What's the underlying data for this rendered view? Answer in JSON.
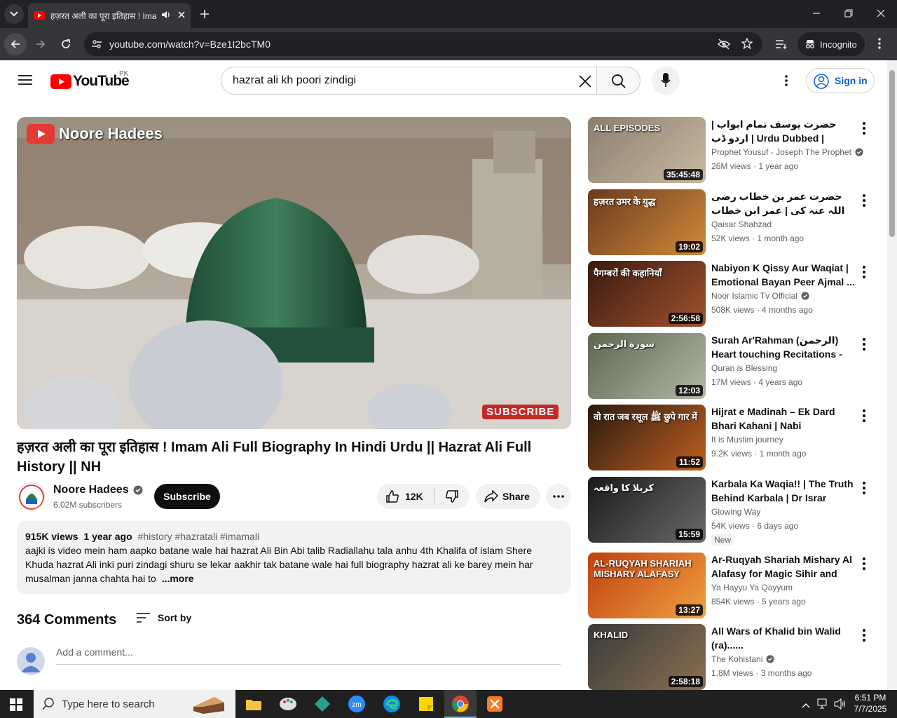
{
  "browser": {
    "tab_title": "हज़रत अली का पूरा इतिहास ! Imam Ali Full Biography In Hindi Urdu || Hazrat Ali Full History || NH",
    "url": "youtube.com/watch?v=Bze1I2bcTM0",
    "incognito_label": "Incognito"
  },
  "youtube": {
    "logo_text": "YouTube",
    "country": "PK",
    "search_value": "hazrat ali kh poori zindigi",
    "sign_in": "Sign in"
  },
  "video": {
    "watermark": "Noore Hadees",
    "subscribe_overlay": "SUBSCRIBE",
    "title": "हज़रत अली का पूरा इतिहास ! Imam Ali Full Biography In Hindi Urdu || Hazrat Ali Full History || NH",
    "channel_name": "Noore Hadees",
    "subscribers": "6.02M subscribers",
    "subscribe_button": "Subscribe",
    "likes": "12K",
    "share": "Share",
    "views": "915K views",
    "age": "1 year ago",
    "hashtags": "#history #hazratali #imamali",
    "description": "aajki is video mein ham aapko batane wale hai hazrat Ali Bin Abi talib Radiallahu tala anhu 4th Khalifa of islam Shere Khuda hazrat Ali inki puri zindagi shuru se lekar aakhir tak batane wale hai full biography hazrat ali ke barey mein har musalman janna chahta hai to",
    "more": "...more"
  },
  "comments": {
    "count": "364 Comments",
    "sort_by": "Sort by",
    "placeholder": "Add a comment..."
  },
  "recommendations": [
    {
      "title": "حضرت یوسف تمام ابواب | اردو ڈب | Urdu Dubbed | Joseph The ...",
      "channel": "Prophet Yousuf - Joseph The Prophet",
      "verified": true,
      "views": "26M views",
      "age": "1 year ago",
      "duration": "35:45:48",
      "thumb_text": "ALL EPISODES",
      "colors": [
        "#8a7f70",
        "#c9b9a0"
      ]
    },
    {
      "title": "حضرت عمر بن خطاب رضی اللہ عنہ کی | عمر ابن خطاب کی فتوحات | حقیقی تاریخ...",
      "channel": "Qaisar Shahzad",
      "verified": false,
      "views": "52K views",
      "age": "1 month ago",
      "duration": "19:02",
      "thumb_text": "हज़रत उमर के युद्ध",
      "colors": [
        "#6b3a1e",
        "#d08a3a"
      ]
    },
    {
      "title": "Nabiyon K Qissy Aur Waqiat | Emotional Bayan Peer Ajmal ...",
      "channel": "Noor Islamic Tv Official",
      "verified": true,
      "views": "508K views",
      "age": "4 months ago",
      "duration": "2:56:58",
      "thumb_text": "पैगम्बरों की कहानियाँ",
      "colors": [
        "#3a1a10",
        "#a0522d"
      ]
    },
    {
      "title": "Surah Ar'Rahman (الرحمن)  Heart touching Recitations - Quran i...",
      "channel": "Quran is Blessing",
      "verified": false,
      "views": "17M views",
      "age": "4 years ago",
      "duration": "12:03",
      "thumb_text": "سورة الرحمن",
      "colors": [
        "#5c6650",
        "#b3b8a6"
      ]
    },
    {
      "title": "Hijrat e Madinah – Ek Dard Bhari Kahani | Nabi Muhamma...",
      "channel": "It is Muslim journey",
      "verified": false,
      "views": "9.2K views",
      "age": "1 month ago",
      "duration": "11:52",
      "thumb_text": "वो रात जब रसूल ﷺ छुपे गार में",
      "colors": [
        "#2a1a10",
        "#c06020"
      ]
    },
    {
      "title": "Karbala Ka Waqia!! | The Truth Behind Karbala | Dr Israr Ahma...",
      "channel": "Glowing Way",
      "verified": false,
      "views": "54K views",
      "age": "6 days ago",
      "duration": "15:59",
      "thumb_text": "کربلا کا واقعہ",
      "colors": [
        "#1a1a1a",
        "#6a6a6a"
      ],
      "badge": "New"
    },
    {
      "title": "Ar-Ruqyah Shariah Mishary Al Alafasy for Magic Sihir and Evi...",
      "channel": "Ya Hayyu Ya Qayyum",
      "verified": false,
      "views": "854K views",
      "age": "5 years ago",
      "duration": "13:27",
      "thumb_text": "AL-RUQYAH SHARIAH MISHARY ALAFASY",
      "colors": [
        "#c04010",
        "#f0a040"
      ]
    },
    {
      "title": "All Wars of Khalid bin Walid (ra)......",
      "channel": "The Kohistani",
      "verified": true,
      "views": "1.8M views",
      "age": "3 months ago",
      "duration": "2:58:18",
      "thumb_text": "KHALID",
      "colors": [
        "#3a3a3a",
        "#8a7050"
      ]
    }
  ],
  "taskbar": {
    "search_placeholder": "Type here to search",
    "time": "6:51 PM",
    "date": "7/7/2025"
  }
}
